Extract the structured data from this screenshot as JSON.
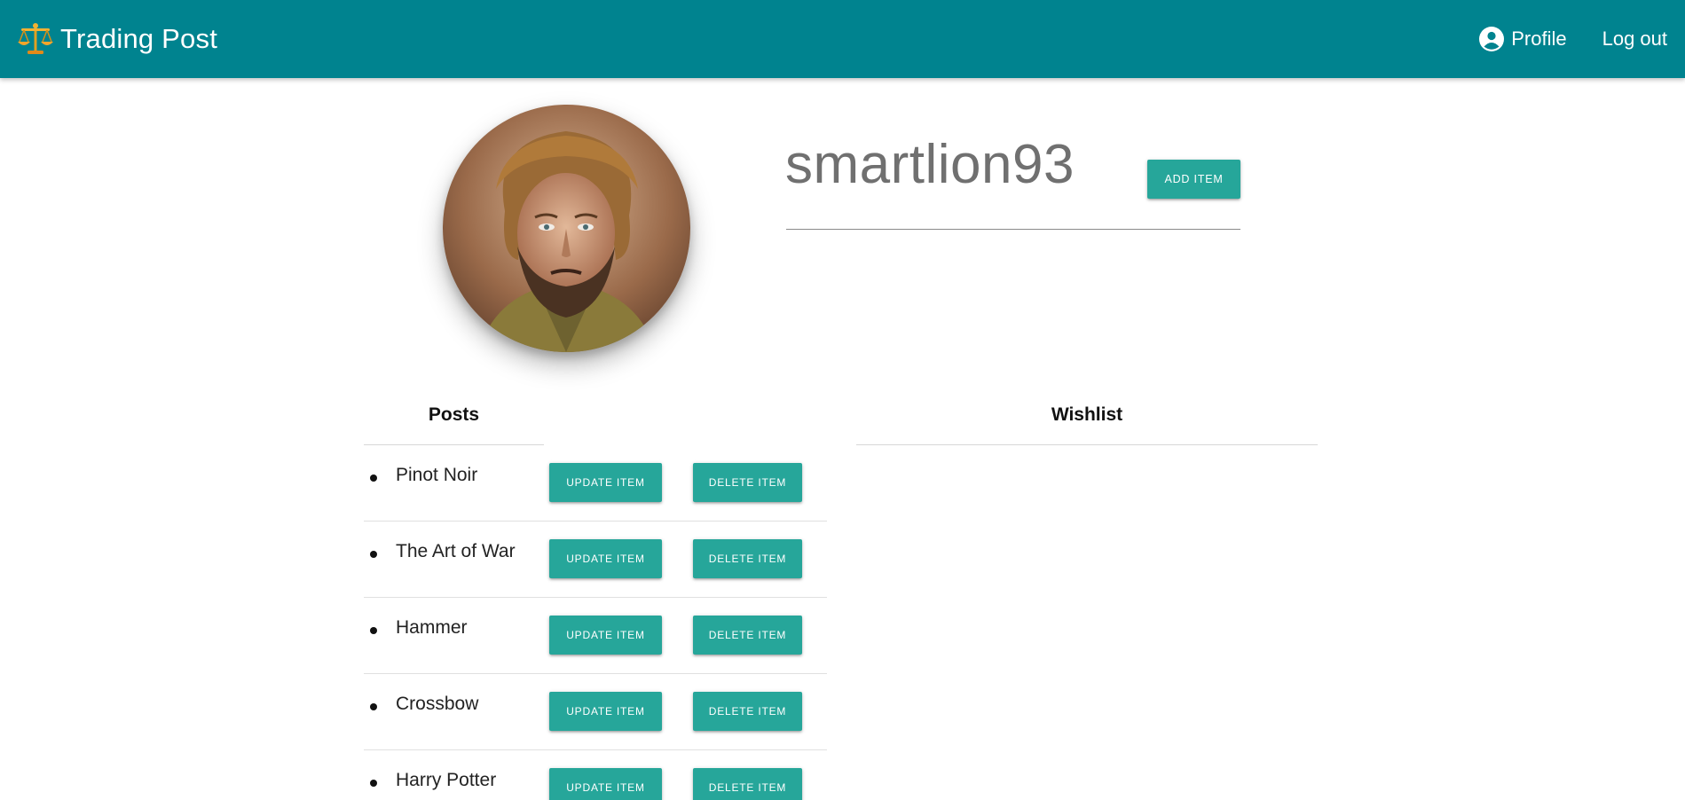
{
  "navbar": {
    "brand_title": "Trading Post",
    "brand_icon": "scales-icon",
    "profile_label": "Profile",
    "profile_icon": "account-circle-icon",
    "logout_label": "Log out",
    "color": "#00838f"
  },
  "profile": {
    "username": "smartlion93",
    "add_item_label": "ADD ITEM",
    "avatar": "profile-photo"
  },
  "posts": {
    "heading": "Posts",
    "update_label": "UPDATE ITEM",
    "delete_label": "DELETE ITEM",
    "items": [
      {
        "name": "Pinot Noir"
      },
      {
        "name": "The Art of War"
      },
      {
        "name": "Hammer"
      },
      {
        "name": "Crossbow"
      },
      {
        "name": "Harry Potter"
      }
    ]
  },
  "wishlist": {
    "heading": "Wishlist",
    "items": []
  },
  "colors": {
    "accent": "#26a69a",
    "navbar": "#00838f"
  }
}
